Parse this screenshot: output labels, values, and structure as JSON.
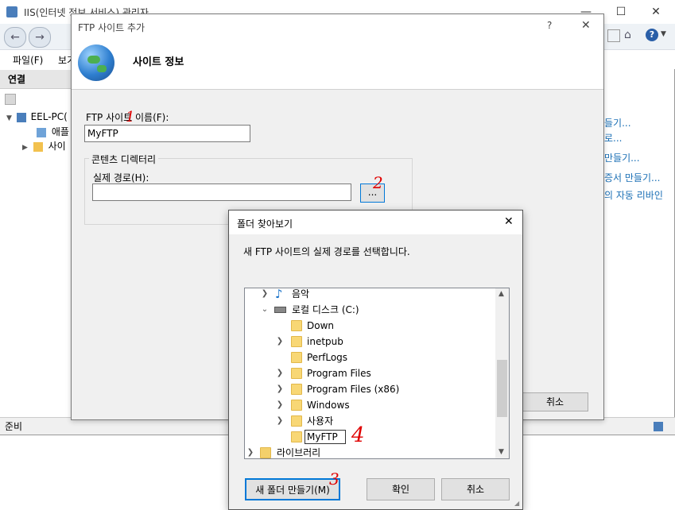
{
  "main_window": {
    "title": "IIS(인터넷 정보 서비스) 관리자",
    "menu": [
      "파일(F)",
      "보기"
    ],
    "connections_header": "연결",
    "tree": [
      {
        "label": "EEL-PC("
      },
      {
        "label": "애플"
      },
      {
        "label": "사이"
      }
    ],
    "actions": [
      "들기...",
      "로...",
      "만들기...",
      "증서 만들기...",
      "의 자동 리바인"
    ],
    "status": "준비"
  },
  "ftp_dialog": {
    "title": "FTP 사이트 추가",
    "help": "?",
    "close": "✕",
    "header": "사이트 정보",
    "site_name_label": "FTP 사이트 이름(F):",
    "site_name_value": "MyFTP",
    "content_dir_label": "콘텐츠 디렉터리",
    "physical_path_label": "실제 경로(H):",
    "physical_path_value": "",
    "browse_label": "...",
    "cancel_label": "취소"
  },
  "folder_dialog": {
    "title": "폴더 찾아보기",
    "close": "✕",
    "description": "새 FTP 사이트의 실제 경로를 선택합니다.",
    "tree": [
      {
        "label": "음악",
        "icon": "music-note-icon",
        "expand": "collapsed"
      },
      {
        "label": "로컬 디스크 (C:)",
        "icon": "drive-icon",
        "expand": "expanded"
      },
      {
        "label": "Down",
        "icon": "folder-icon",
        "expand": "none"
      },
      {
        "label": "inetpub",
        "icon": "folder-icon",
        "expand": "collapsed"
      },
      {
        "label": "PerfLogs",
        "icon": "folder-icon",
        "expand": "none"
      },
      {
        "label": "Program Files",
        "icon": "folder-icon",
        "expand": "collapsed"
      },
      {
        "label": "Program Files (x86)",
        "icon": "folder-icon",
        "expand": "collapsed"
      },
      {
        "label": "Windows",
        "icon": "folder-icon",
        "expand": "collapsed"
      },
      {
        "label": "사용자",
        "icon": "folder-icon",
        "expand": "collapsed"
      },
      {
        "label": "",
        "icon": "folder-icon",
        "expand": "none"
      },
      {
        "label": "라이브러리",
        "icon": "library-icon",
        "expand": "collapsed"
      }
    ],
    "rename_value": "MyFTP",
    "new_folder_label": "새 폴더 만들기(M)",
    "ok_label": "확인",
    "cancel_label": "취소"
  },
  "annotations": [
    "1",
    "2",
    "3",
    "4"
  ]
}
